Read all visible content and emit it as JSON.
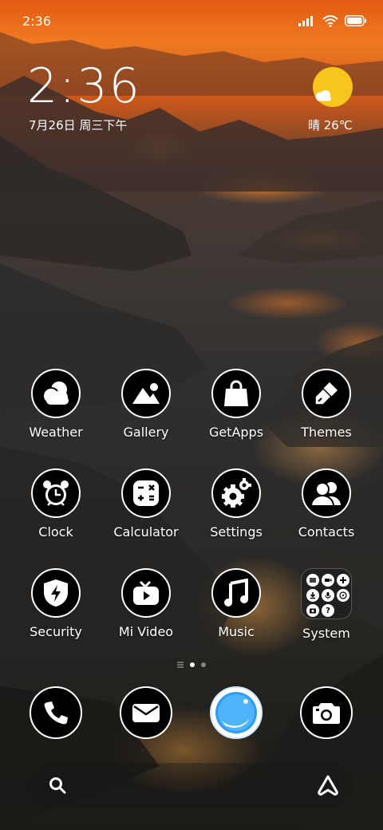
{
  "status_bar": {
    "time": "2:36"
  },
  "clock_widget": {
    "time": "2:36",
    "date": "7月26日 周三下午"
  },
  "weather_widget": {
    "text": "晴 26℃"
  },
  "apps": [
    {
      "label": "Weather",
      "icon": "weather-icon"
    },
    {
      "label": "Gallery",
      "icon": "gallery-icon"
    },
    {
      "label": "GetApps",
      "icon": "getapps-icon"
    },
    {
      "label": "Themes",
      "icon": "themes-icon"
    },
    {
      "label": "Clock",
      "icon": "alarm-clock-icon"
    },
    {
      "label": "Calculator",
      "icon": "calculator-icon"
    },
    {
      "label": "Settings",
      "icon": "settings-gear-icon"
    },
    {
      "label": "Contacts",
      "icon": "contacts-icon"
    },
    {
      "label": "Security",
      "icon": "security-shield-icon"
    },
    {
      "label": "Mi Video",
      "icon": "mi-video-icon"
    },
    {
      "label": "Music",
      "icon": "music-note-icon"
    },
    {
      "label": "System",
      "icon": "system-folder-icon"
    }
  ],
  "folder_mini_icons": [
    "file-manager-icon",
    "recorder-icon",
    "plus-icon",
    "download-icon",
    "mic-icon",
    "compass-icon",
    "screen-recorder-icon",
    "question-icon"
  ],
  "page_indicator": {
    "pages": 2,
    "current": 1
  },
  "dock": [
    {
      "icon": "phone-icon"
    },
    {
      "icon": "messages-icon"
    },
    {
      "icon": "browser-icon"
    },
    {
      "icon": "camera-icon"
    }
  ],
  "search_bar": {
    "left_icon": "search-icon",
    "right_icon": "assistant-icon"
  },
  "colors": {
    "accent_browser": "#2b9df4",
    "sun": "#f8c51d"
  }
}
